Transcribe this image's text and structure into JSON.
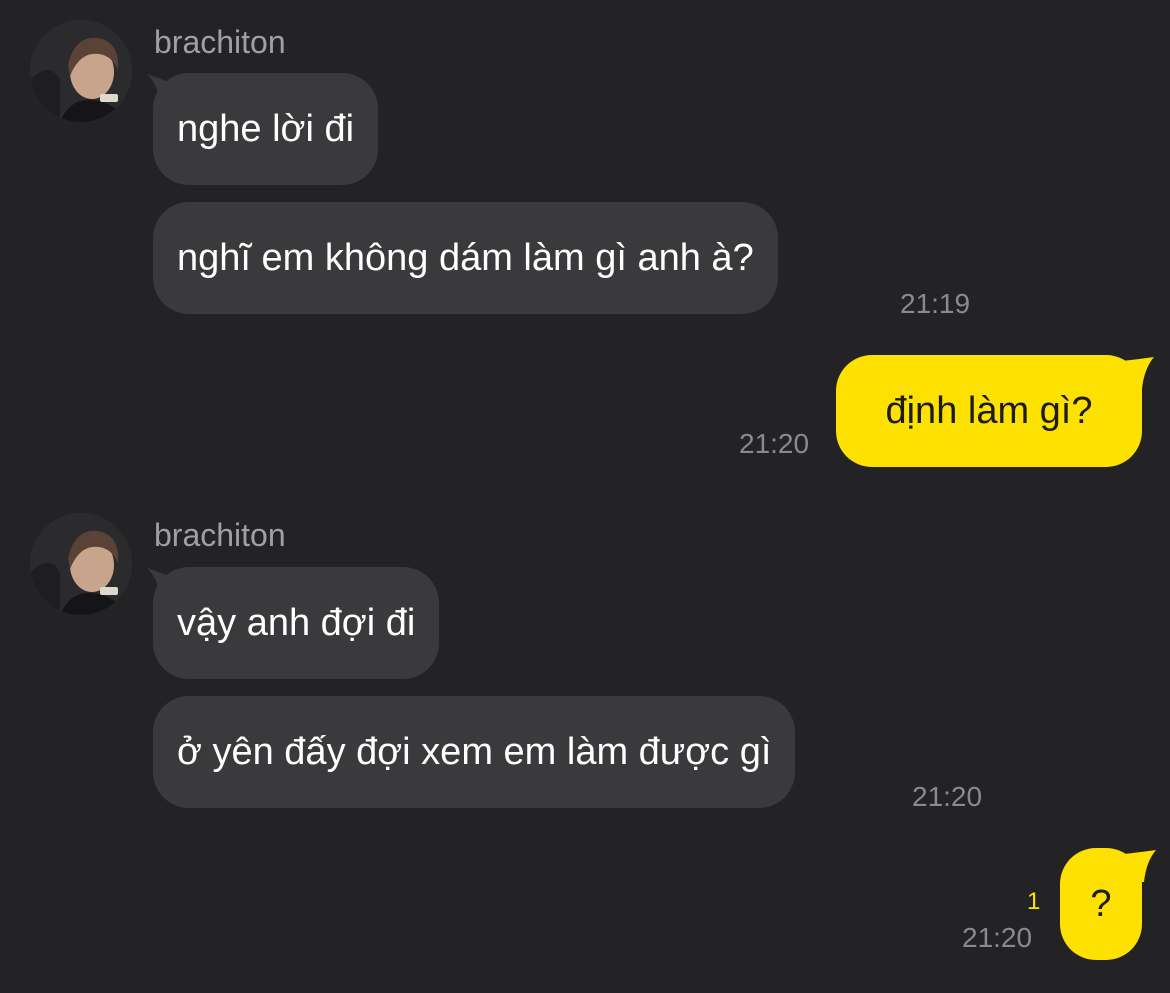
{
  "theme": {
    "background": "#232325",
    "incoming_bubble": "#3a3a3c",
    "outgoing_bubble": "#fde100",
    "sender_name_color": "#a0a0a4",
    "time_color": "#8a8a8e",
    "unread_color": "#fde100"
  },
  "groups": [
    {
      "sender": "brachiton",
      "avatar_icon": "profile-photo",
      "messages": [
        "nghe lời đi",
        "nghĩ em không dám làm gì anh à?"
      ],
      "time": "21:19"
    },
    {
      "outgoing": true,
      "messages": [
        "định làm gì?"
      ],
      "time": "21:20"
    },
    {
      "sender": "brachiton",
      "avatar_icon": "profile-photo",
      "messages": [
        "vậy anh đợi đi",
        "ở yên đấy đợi xem em làm được gì"
      ],
      "time": "21:20"
    },
    {
      "outgoing": true,
      "messages": [
        "?"
      ],
      "time": "21:20",
      "unread_count": "1"
    }
  ]
}
